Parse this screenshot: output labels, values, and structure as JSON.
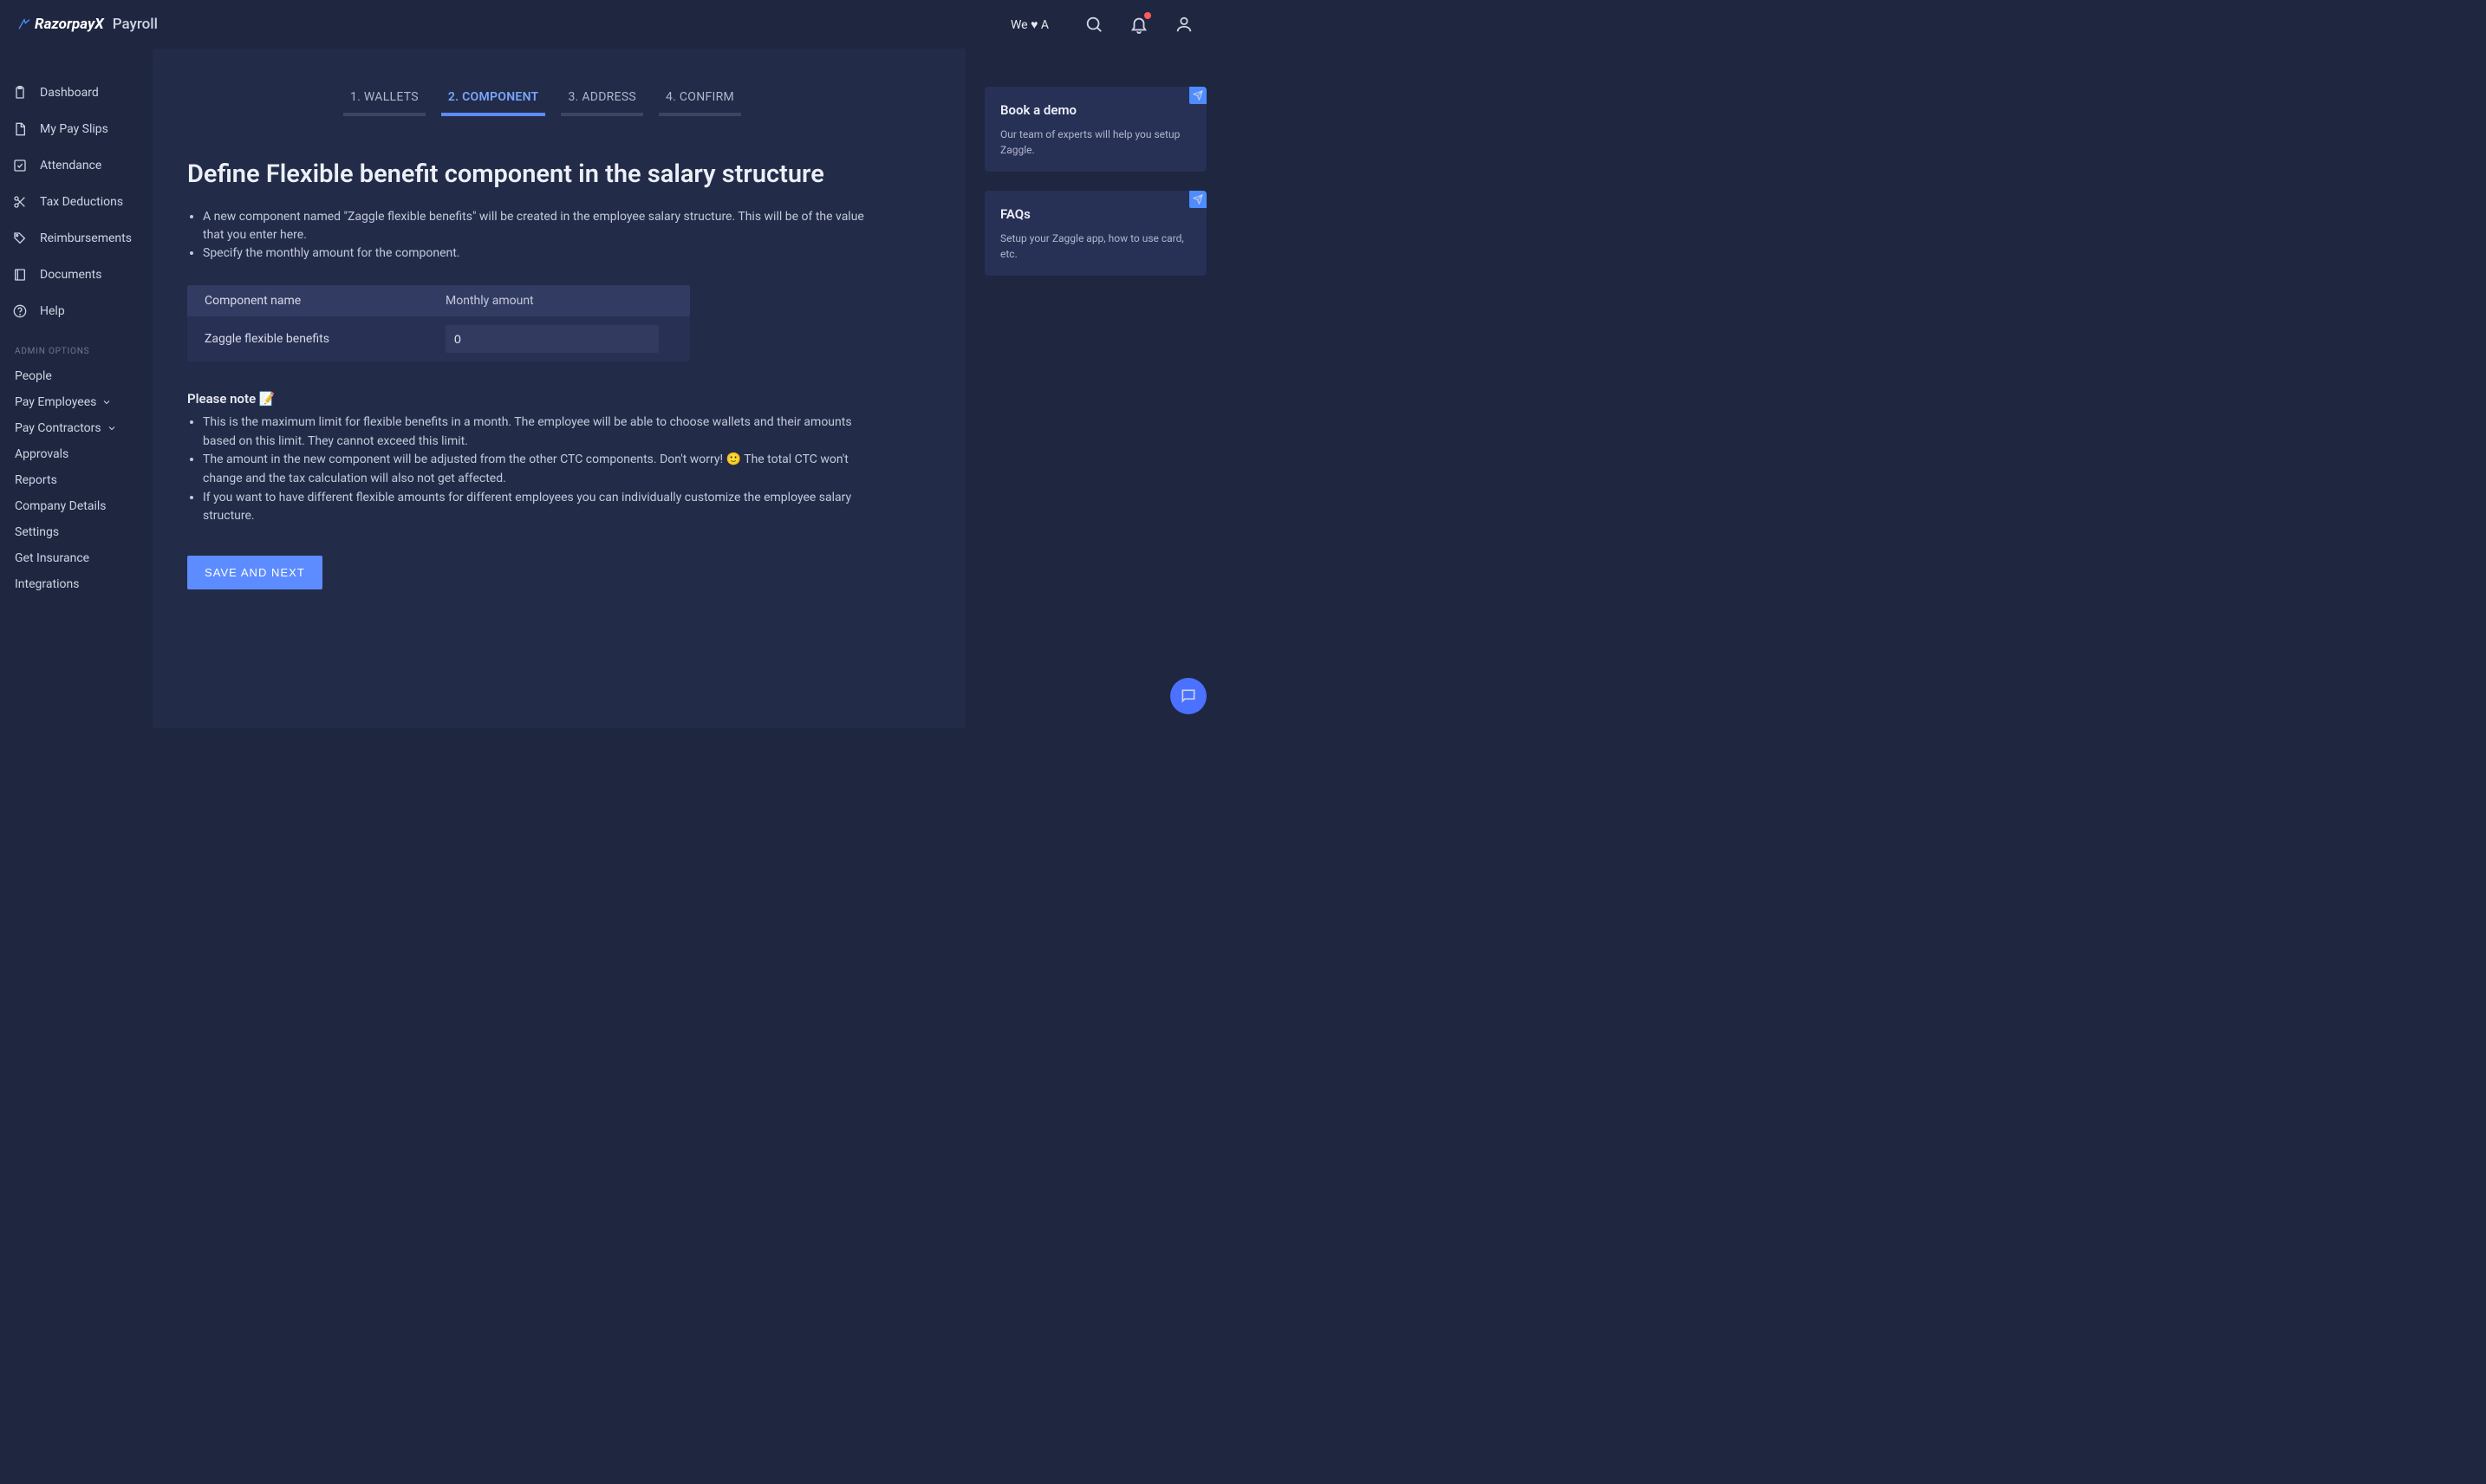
{
  "header": {
    "brand_main": "RazorpayX",
    "brand_sub": "Payroll",
    "promo": "We ♥ A"
  },
  "sidebar": {
    "items": [
      {
        "label": "Dashboard"
      },
      {
        "label": "My Pay Slips"
      },
      {
        "label": "Attendance"
      },
      {
        "label": "Tax Deductions"
      },
      {
        "label": "Reimbursements"
      },
      {
        "label": "Documents"
      },
      {
        "label": "Help"
      }
    ],
    "admin_label": "ADMIN OPTIONS",
    "admin_items": [
      {
        "label": "People"
      },
      {
        "label": "Pay Employees"
      },
      {
        "label": "Pay Contractors"
      },
      {
        "label": "Approvals"
      },
      {
        "label": "Reports"
      },
      {
        "label": "Company Details"
      },
      {
        "label": "Settings"
      },
      {
        "label": "Get Insurance"
      },
      {
        "label": "Integrations"
      }
    ]
  },
  "steps": [
    {
      "label": "1. WALLETS"
    },
    {
      "label": "2. COMPONENT"
    },
    {
      "label": "3. ADDRESS"
    },
    {
      "label": "4. CONFIRM"
    }
  ],
  "main": {
    "title": "Define Flexible benefit component in the salary structure",
    "intro": [
      "A new component named \"Zaggle flexible benefits\" will be created in the employee salary structure. This will be of the value that you enter here.",
      "Specify the monthly amount for the component."
    ],
    "table": {
      "head_col1": "Component name",
      "head_col2": "Monthly amount",
      "row_name": "Zaggle flexible benefits",
      "row_amount": "0"
    },
    "note_title": "Please note 📝",
    "notes": [
      "This is the maximum limit for flexible benefits in a month. The employee will be able to choose wallets and their amounts based on this limit. They cannot exceed this limit.",
      "The amount in the new component will be adjusted from the other CTC components. Don't worry! 🙂 The total CTC won't change and the tax calculation will also not get affected.",
      "If you want to have different flexible amounts for different employees you can individually customize the employee salary structure."
    ],
    "save_label": "SAVE AND NEXT"
  },
  "right": {
    "demo_title": "Book a demo",
    "demo_text": "Our team of experts will help you setup Zaggle.",
    "faq_title": "FAQs",
    "faq_text": "Setup your Zaggle app, how to use card, etc."
  }
}
